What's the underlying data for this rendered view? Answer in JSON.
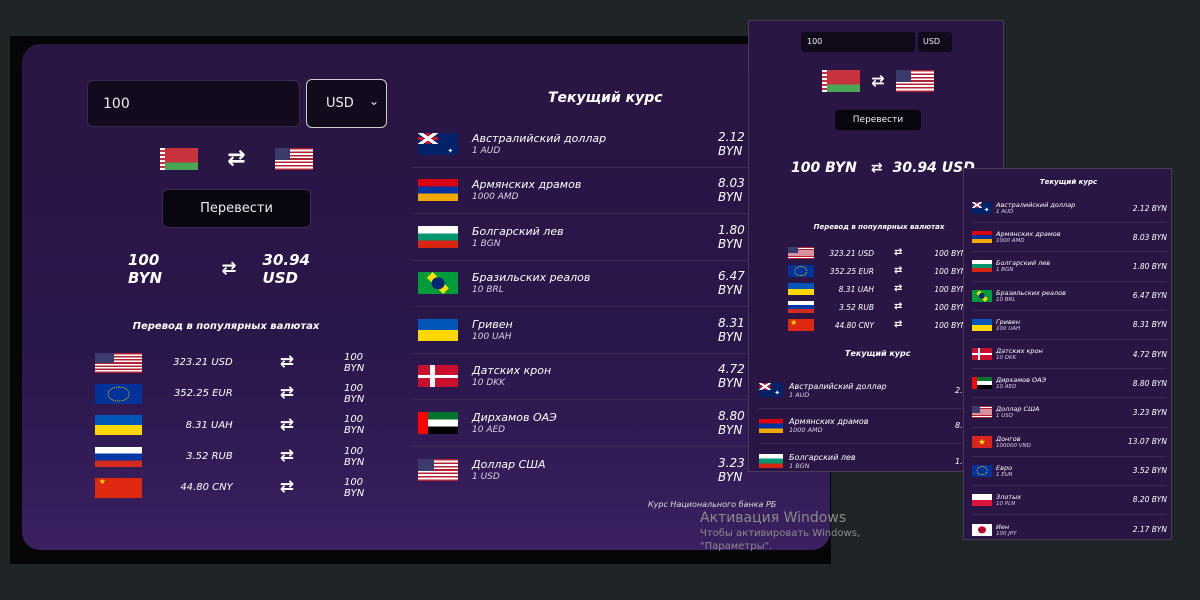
{
  "desktop": {
    "converter": {
      "amount_value": "100",
      "currency_selected": "USD",
      "convert_button": "Перевести",
      "result_from": "100 BYN",
      "result_to": "30.94 USD"
    },
    "popular": {
      "title": "Перевод в популярных валютах",
      "rows": [
        {
          "flag": "us",
          "value": "323.21 USD",
          "byn": "100 BYN"
        },
        {
          "flag": "eu",
          "value": "352.25 EUR",
          "byn": "100 BYN"
        },
        {
          "flag": "ua",
          "value": "8.31 UAH",
          "byn": "100 BYN"
        },
        {
          "flag": "ru",
          "value": "3.52 RUB",
          "byn": "100 BYN"
        },
        {
          "flag": "cn",
          "value": "44.80 CNY",
          "byn": "100 BYN"
        }
      ]
    },
    "rates": {
      "title": "Текущий курс",
      "rows": [
        {
          "flag": "au",
          "name": "Австралийский доллар",
          "amount": "1 AUD",
          "value": "2.12 BYN"
        },
        {
          "flag": "am",
          "name": "Армянских драмов",
          "amount": "1000 AMD",
          "value": "8.03 BYN"
        },
        {
          "flag": "bg",
          "name": "Болгарский лев",
          "amount": "1 BGN",
          "value": "1.80 BYN"
        },
        {
          "flag": "br",
          "name": "Бразильских реалов",
          "amount": "10 BRL",
          "value": "6.47 BYN"
        },
        {
          "flag": "ua",
          "name": "Гривен",
          "amount": "100 UAH",
          "value": "8.31 BYN"
        },
        {
          "flag": "dk",
          "name": "Датских крон",
          "amount": "10 DKK",
          "value": "4.72 BYN"
        },
        {
          "flag": "ae",
          "name": "Дирхамов ОАЭ",
          "amount": "10 AED",
          "value": "8.80 BYN"
        },
        {
          "flag": "us",
          "name": "Доллар США",
          "amount": "1 USD",
          "value": "3.23 BYN"
        }
      ],
      "note": "Курс Национального банка РБ"
    }
  },
  "watermark": {
    "title": "Активация Windows",
    "line1": "Чтобы активировать Windows,",
    "line2": "\"Параметры\"."
  },
  "tablet": {
    "amount_value": "100",
    "currency_selected": "USD",
    "convert_button": "Перевести",
    "result_from": "100 BYN",
    "result_to": "30.94 USD",
    "popular_title": "Перевод в популярных валютах",
    "popular_rows": [
      {
        "flag": "us",
        "value": "323.21 USD",
        "byn": "100 BYN"
      },
      {
        "flag": "eu",
        "value": "352.25 EUR",
        "byn": "100 BYN"
      },
      {
        "flag": "ua",
        "value": "8.31 UAH",
        "byn": "100 BYN"
      },
      {
        "flag": "ru",
        "value": "3.52 RUB",
        "byn": "100 BYN"
      },
      {
        "flag": "cn",
        "value": "44.80 CNY",
        "byn": "100 BYN"
      }
    ],
    "rates_title": "Текущий курс",
    "rates_rows": [
      {
        "flag": "au",
        "name": "Австралийский доллар",
        "amount": "1 AUD",
        "value": "2.12 BYN"
      },
      {
        "flag": "am",
        "name": "Армянских драмов",
        "amount": "1000 AMD",
        "value": "8.03 BYN"
      },
      {
        "flag": "bg",
        "name": "Болгарский лев",
        "amount": "1 BGN",
        "value": "1.80 BYN"
      }
    ]
  },
  "mobile": {
    "rates_title": "Текущий курс",
    "rates_rows": [
      {
        "flag": "au",
        "name": "Австралийский доллар",
        "amount": "1 AUD",
        "value": "2.12 BYN"
      },
      {
        "flag": "am",
        "name": "Армянских драмов",
        "amount": "1000 AMD",
        "value": "8.03 BYN"
      },
      {
        "flag": "bg",
        "name": "Болгарский лев",
        "amount": "1 BGN",
        "value": "1.80 BYN"
      },
      {
        "flag": "br",
        "name": "Бразильских реалов",
        "amount": "10 BRL",
        "value": "6.47 BYN"
      },
      {
        "flag": "ua",
        "name": "Гривен",
        "amount": "100 UAH",
        "value": "8.31 BYN"
      },
      {
        "flag": "dk",
        "name": "Датских крон",
        "amount": "10 DKK",
        "value": "4.72 BYN"
      },
      {
        "flag": "ae",
        "name": "Дирхамов ОАЭ",
        "amount": "10 AED",
        "value": "8.80 BYN"
      },
      {
        "flag": "us",
        "name": "Доллар США",
        "amount": "1 USD",
        "value": "3.23 BYN"
      },
      {
        "flag": "vn",
        "name": "Донгов",
        "amount": "100000 VND",
        "value": "13.07 BYN"
      },
      {
        "flag": "eu",
        "name": "Евро",
        "amount": "1 EUR",
        "value": "3.52 BYN"
      },
      {
        "flag": "pl",
        "name": "Злотых",
        "amount": "10 PLN",
        "value": "8.20 BYN"
      },
      {
        "flag": "jp",
        "name": "Иен",
        "amount": "100 JPY",
        "value": "2.17 BYN"
      }
    ]
  },
  "icons": {
    "swap": "⇄",
    "chevron": "⌄"
  },
  "colors": {
    "page_bg": "#1f2527",
    "card_bg": "#2a1542",
    "input_bg": "#130a1d"
  }
}
